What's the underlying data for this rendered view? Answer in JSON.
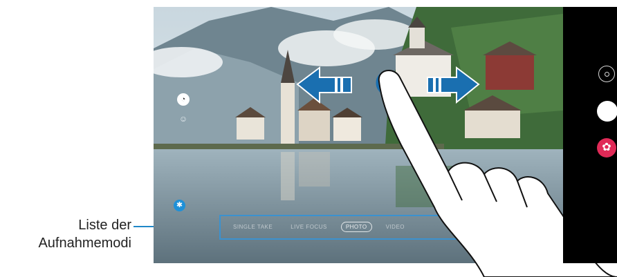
{
  "callout": {
    "line1": "Liste der",
    "line2": "Aufnahmemodi"
  },
  "modes": {
    "items": [
      "SINGLE TAKE",
      "LIVE FOCUS",
      "PHOTO",
      "VIDEO"
    ],
    "selected": "PHOTO"
  },
  "icons": {
    "filter": "filter-icon",
    "face": "face-effect-icon",
    "scene": "scene-optimizer-icon",
    "switch_camera": "switch-camera-icon",
    "shutter": "shutter-button",
    "effects": "effects-icon"
  },
  "colors": {
    "accent_blue": "#1f87c8",
    "effects_pink": "#e02a57",
    "arrow_blue": "#1a6fb0"
  }
}
